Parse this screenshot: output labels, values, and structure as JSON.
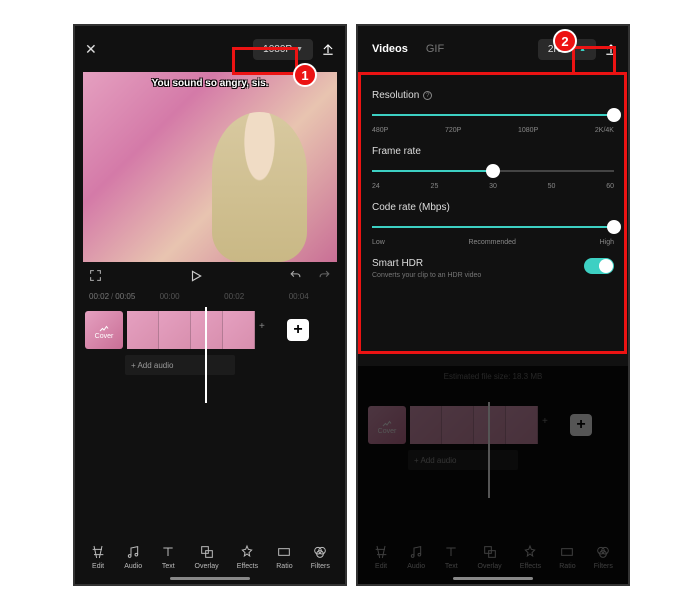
{
  "annotations": {
    "step1": "1",
    "step2": "2"
  },
  "left": {
    "resolution": "1080P",
    "caption": "You sound so angry, sis.",
    "time_current": "00:02",
    "time_total": "00:05",
    "marks": [
      "00:00",
      "00:02",
      "00:04"
    ],
    "cover_label": "Cover",
    "add_audio": "+ Add audio",
    "tools": [
      "Edit",
      "Audio",
      "Text",
      "Overlay",
      "Effects",
      "Ratio",
      "Filters"
    ]
  },
  "right": {
    "tabs": {
      "videos": "Videos",
      "gif": "GIF"
    },
    "resolution_pill": "2K/4K",
    "resolution": {
      "label": "Resolution",
      "ticks": [
        "480P",
        "720P",
        "1080P",
        "2K/4K"
      ]
    },
    "framerate": {
      "label": "Frame rate",
      "ticks": [
        "24",
        "25",
        "30",
        "50",
        "60"
      ]
    },
    "coderate": {
      "label": "Code rate (Mbps)",
      "ticks": [
        "Low",
        "Recommended",
        "High"
      ]
    },
    "hdr": {
      "label": "Smart HDR",
      "sub": "Converts your clip to an HDR video"
    },
    "estimate": "Estimated file size: 18.3 MB",
    "cover_label": "Cover",
    "add_audio": "+ Add audio",
    "tools": [
      "Edit",
      "Audio",
      "Text",
      "Overlay",
      "Effects",
      "Ratio",
      "Filters"
    ]
  }
}
